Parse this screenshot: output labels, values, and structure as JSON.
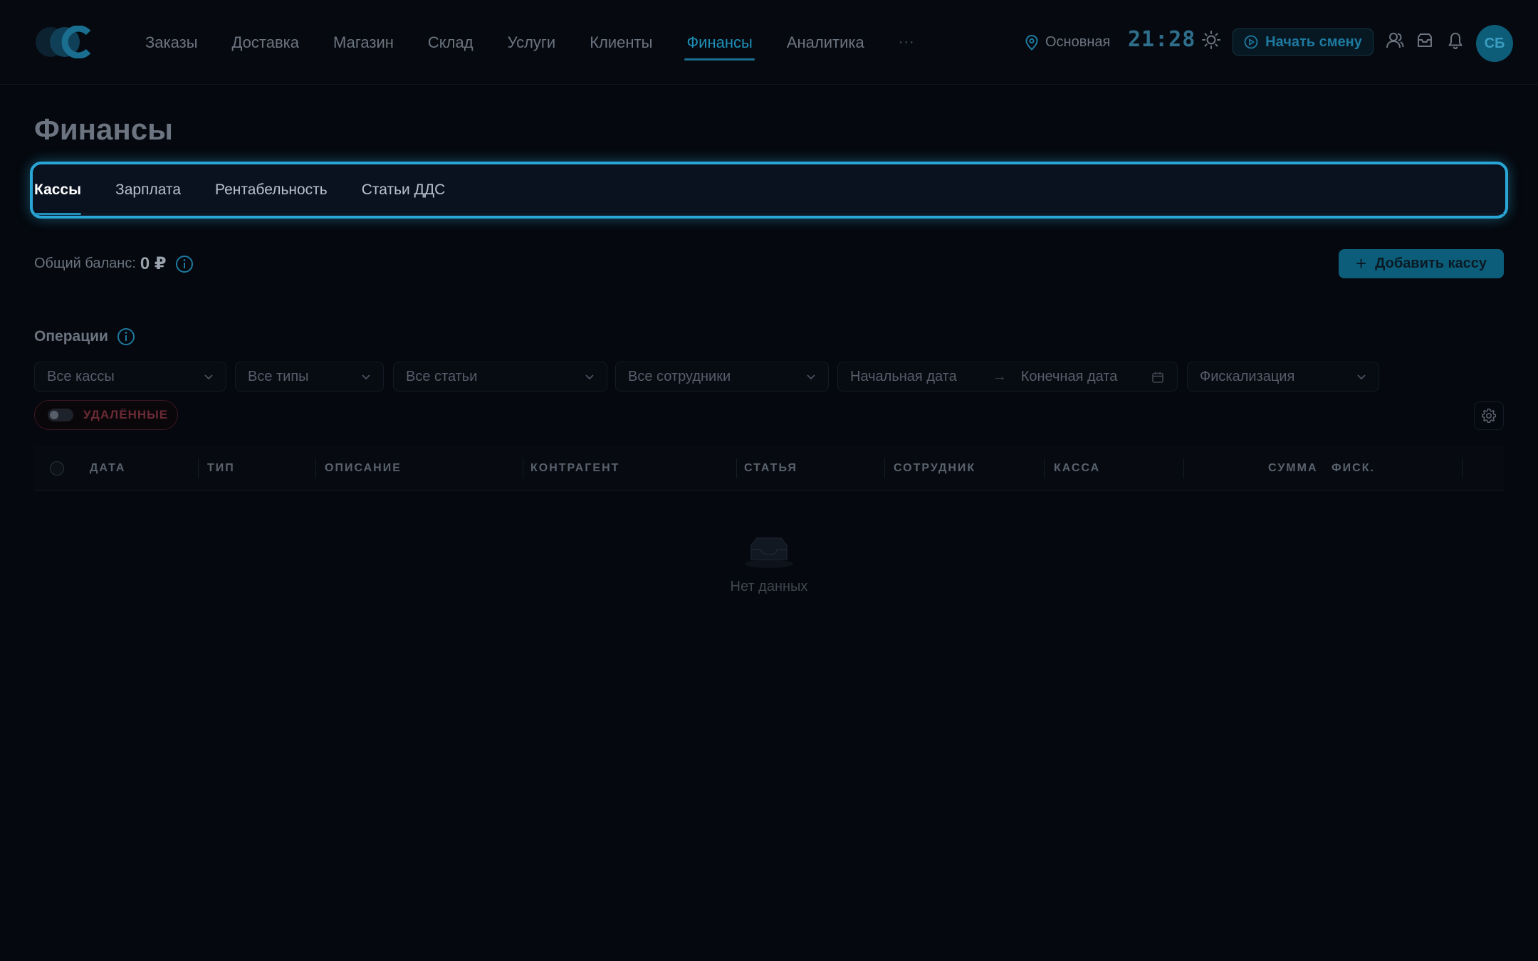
{
  "header": {
    "nav": [
      {
        "label": "Заказы"
      },
      {
        "label": "Доставка"
      },
      {
        "label": "Магазин"
      },
      {
        "label": "Склад"
      },
      {
        "label": "Услуги"
      },
      {
        "label": "Клиенты"
      },
      {
        "label": "Финансы",
        "active": true
      },
      {
        "label": "Аналитика"
      }
    ],
    "more": "···",
    "location": "Основная",
    "clock": "21:28",
    "shift_button": "Начать смену",
    "avatar_initials": "СБ",
    "accent_color": "#1e8fb8"
  },
  "page": {
    "title": "Финансы",
    "tabs": [
      {
        "label": "Кассы",
        "active": true
      },
      {
        "label": "Зарплата"
      },
      {
        "label": "Рентабельность"
      },
      {
        "label": "Статьи ДДС"
      }
    ],
    "balance_label": "Общий баланс:",
    "balance_value": "0 ₽",
    "add_button": "Добавить кассу"
  },
  "operations": {
    "title": "Операции",
    "filters": {
      "cash": "Все кассы",
      "types": "Все типы",
      "items": "Все статьи",
      "employees": "Все сотрудники",
      "start_date": "Начальная дата",
      "end_date": "Конечная дата",
      "fiscal": "Фискализация"
    },
    "deleted_toggle": "УДАЛЁННЫЕ",
    "columns": {
      "date": "ДАТА",
      "type": "ТИП",
      "description": "ОПИСАНИЕ",
      "counterparty": "КОНТРАГЕНТ",
      "item": "СТАТЬЯ",
      "employee": "СОТРУДНИК",
      "cash": "КАССА",
      "amount": "СУММА",
      "fiscal": "ФИСК."
    },
    "empty_text": "Нет данных"
  }
}
